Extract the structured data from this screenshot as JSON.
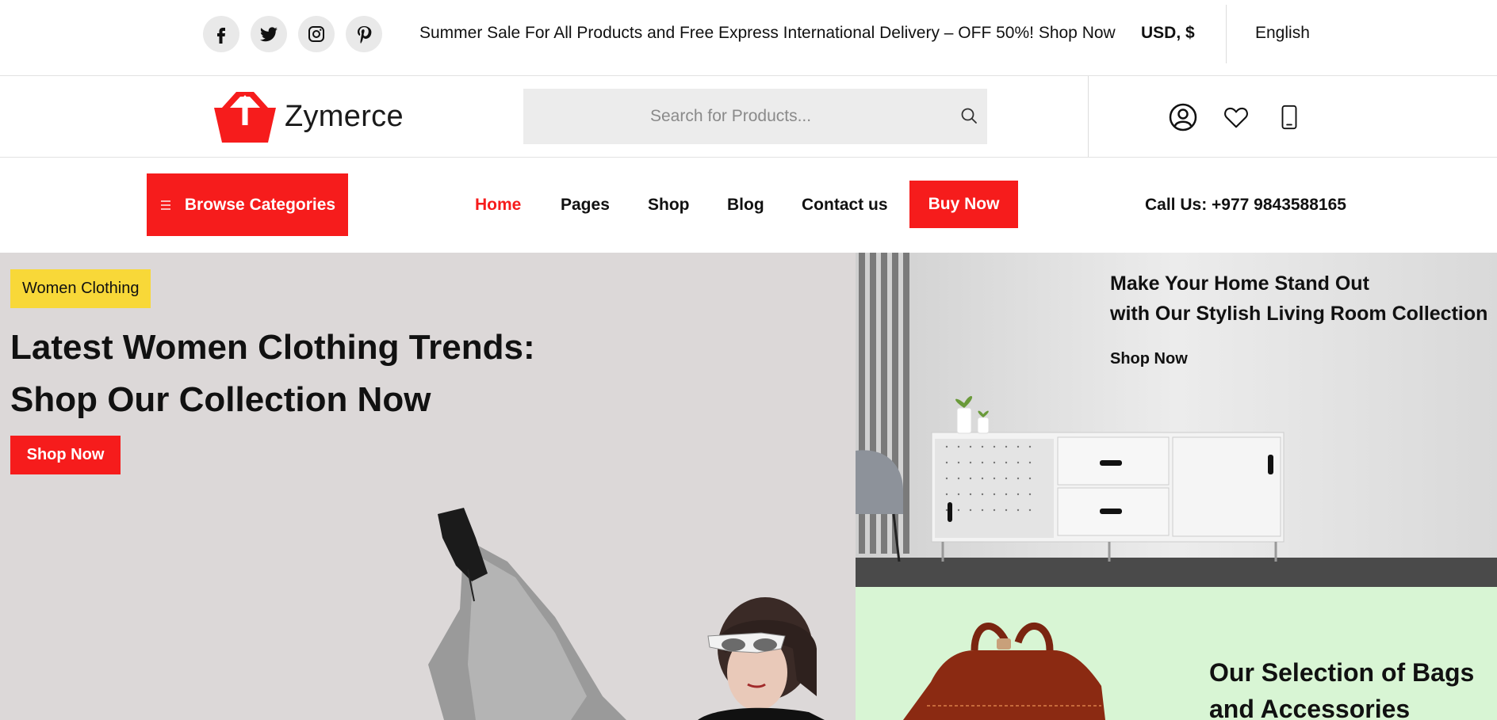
{
  "topbar": {
    "social": [
      {
        "name": "facebook-icon"
      },
      {
        "name": "twitter-icon"
      },
      {
        "name": "instagram-icon"
      },
      {
        "name": "pinterest-icon"
      }
    ],
    "promo_text": "Summer Sale For All Products and Free Express International Delivery – OFF 50%! Shop Now",
    "currency": "USD, $",
    "language": "English"
  },
  "header": {
    "brand": "Zymerce",
    "search_placeholder": "Search for Products...",
    "icons": [
      "user-account-icon",
      "wishlist-heart-icon",
      "mobile-phone-icon"
    ]
  },
  "nav": {
    "browse_label": "Browse Categories",
    "links": [
      "Home",
      "Pages",
      "Shop",
      "Blog",
      "Contact us"
    ],
    "active": "Home",
    "buy_label": "Buy Now",
    "call_us": "Call Us: +977 9843588165"
  },
  "hero_left": {
    "tag": "Women Clothing",
    "title_line1": "Latest Women Clothing Trends:",
    "title_line2": "Shop Our Collection Now",
    "button": "Shop Now"
  },
  "hero_right_top": {
    "title_line1": "Make Your Home Stand Out",
    "title_line2": "with Our Stylish Living Room Collection",
    "link": "Shop Now"
  },
  "hero_right_bottom": {
    "title_line1": "Our Selection of Bags",
    "title_line2": "and Accessories"
  },
  "colors": {
    "accent": "#f61c1c",
    "tag_yellow": "#f8d838",
    "hero_left_bg": "#dcd8d8",
    "hero_right_top_bg": "#e2e2e2",
    "hero_right_bottom_bg": "#d8f5d4"
  }
}
